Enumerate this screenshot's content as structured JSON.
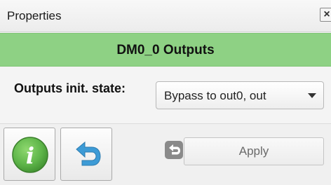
{
  "panel": {
    "title": "Properties",
    "close_glyph": "✕"
  },
  "section": {
    "header": "DM0_0 Outputs"
  },
  "fields": {
    "outputs_init_state": {
      "label": "Outputs init. state:",
      "value": "Bypass to out0, out"
    }
  },
  "toolbar": {
    "info_icon": "info-icon",
    "revert_icon": "revert-arrow-icon",
    "apply_label": "Apply"
  },
  "colors": {
    "header_bg": "#8ed184",
    "info_green": "#5fb64a",
    "revert_blue": "#3d9bd6"
  }
}
